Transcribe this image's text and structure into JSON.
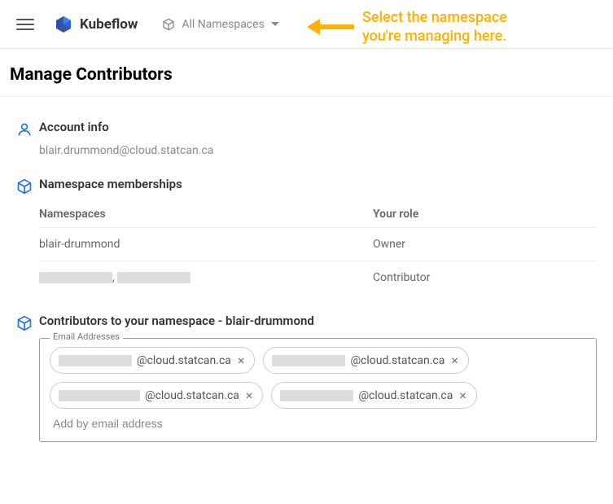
{
  "topbar": {
    "brand": "Kubeflow",
    "ns_selector_label": "All Namespaces"
  },
  "annotation": {
    "line1": "Select the namespace",
    "line2": "you're managing here."
  },
  "page_title": "Manage Contributors",
  "account": {
    "title": "Account info",
    "email": "blair.drummond@cloud.statcan.ca"
  },
  "memberships": {
    "title": "Namespace memberships",
    "col_namespaces": "Namespaces",
    "col_role": "Your role",
    "rows": [
      {
        "ns": "blair-drummond",
        "role": "Owner",
        "sep": "",
        "redacted": false
      },
      {
        "ns": "",
        "role": "Contributor",
        "sep": ",",
        "redacted": true
      }
    ]
  },
  "contributors": {
    "title_prefix": "Contributors to your namespace - ",
    "namespace": "blair-drummond",
    "fieldset_label": "Email Addresses",
    "add_placeholder": "Add by email address",
    "chips": [
      {
        "suffix": "@cloud.statcan.ca",
        "redact_w": 90
      },
      {
        "suffix": "@cloud.statcan.ca",
        "redact_w": 90
      },
      {
        "suffix": "@cloud.statcan.ca",
        "redact_w": 100
      },
      {
        "suffix": "@cloud.statcan.ca",
        "redact_w": 90
      }
    ]
  },
  "colors": {
    "accent_blue": "#1f6feb",
    "annotation_orange": "#ffb000"
  }
}
